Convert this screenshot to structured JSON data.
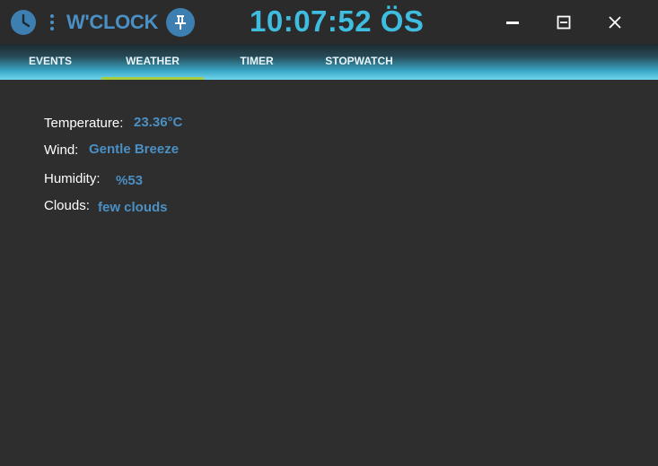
{
  "header": {
    "app_title": "W'CLOCK",
    "time": "10:07:52 ÖS"
  },
  "icons": {
    "clock": "clock-icon",
    "menu": "vertical-dots-icon",
    "pin": "pin-icon",
    "minimize": "minimize-icon",
    "maximize": "maximize-icon",
    "close": "close-icon"
  },
  "colors": {
    "accent_blue": "#4a90c4",
    "time_cyan": "#3fbde0",
    "tab_indicator": "#a5cf3f",
    "background": "#2e2e2e"
  },
  "tabs": [
    {
      "label": "EVENTS"
    },
    {
      "label": "WEATHER",
      "active": true
    },
    {
      "label": "TIMER"
    },
    {
      "label": "STOPWATCH"
    }
  ],
  "weather": {
    "temperature_label": "Temperature:",
    "temperature_value": "23.36°C",
    "wind_label": "Wind:",
    "wind_value": "Gentle Breeze",
    "humidity_label": "Humidity:",
    "humidity_value": "%53",
    "clouds_label": "Clouds:",
    "clouds_value": "few clouds"
  }
}
